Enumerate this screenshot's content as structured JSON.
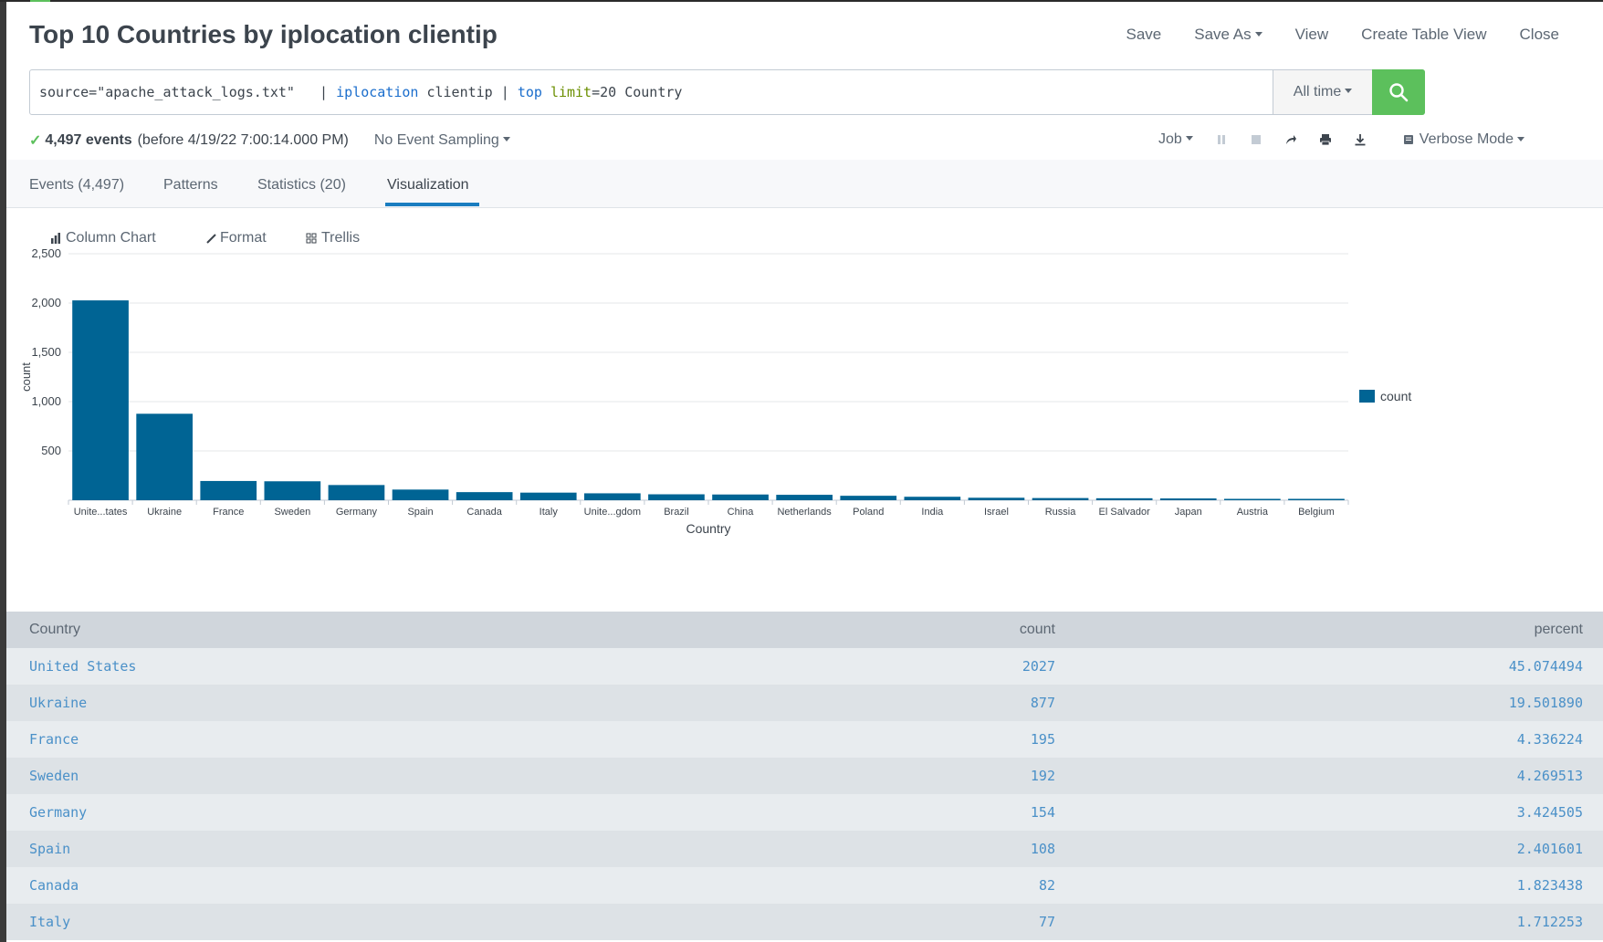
{
  "title": "Top 10 Countries by iplocation clientip",
  "header_actions": [
    "Save",
    "Save As",
    "View",
    "Create Table View",
    "Close"
  ],
  "search": {
    "query_parts": {
      "source": "source=\"apache_attack_logs.txt\"",
      "pipe1": "   | ",
      "cmd1": "iplocation",
      "arg1": " clientip | ",
      "cmd2": "top",
      "sp": " ",
      "opt": "limit",
      "rest": "=20 Country"
    },
    "time_range": "All time"
  },
  "status": {
    "count_text": "4,497 events",
    "detail": "(before 4/19/22 7:00:14.000 PM)",
    "sampling": "No Event Sampling",
    "job_label": "Job",
    "mode": "Verbose Mode"
  },
  "tabs": [
    "Events (4,497)",
    "Patterns",
    "Statistics (20)",
    "Visualization"
  ],
  "viz_toolbar": {
    "chart_type": "Column Chart",
    "format": "Format",
    "trellis": "Trellis"
  },
  "chart_data": {
    "type": "bar",
    "categories": [
      "Unite...tates",
      "Ukraine",
      "France",
      "Sweden",
      "Germany",
      "Spain",
      "Canada",
      "Italy",
      "Unite...gdom",
      "Brazil",
      "China",
      "Netherlands",
      "Poland",
      "India",
      "Israel",
      "Russia",
      "El Salvador",
      "Japan",
      "Austria",
      "Belgium"
    ],
    "series": [
      {
        "name": "count",
        "values": [
          2027,
          877,
          195,
          192,
          154,
          108,
          82,
          77,
          70,
          60,
          58,
          55,
          45,
          35,
          25,
          22,
          20,
          18,
          12,
          10
        ],
        "color": "#006494"
      }
    ],
    "ylim": [
      0,
      2500
    ],
    "yticks": [
      "500",
      "1,000",
      "1,500",
      "2,000",
      "2,500"
    ],
    "ytick_values": [
      500,
      1000,
      1500,
      2000,
      2500
    ],
    "xlabel": "Country",
    "ylabel": "count",
    "legend_position": "right",
    "grid": true
  },
  "table": {
    "columns": [
      "Country",
      "count",
      "percent"
    ],
    "rows": [
      [
        "United States",
        "2027",
        "45.074494"
      ],
      [
        "Ukraine",
        "877",
        "19.501890"
      ],
      [
        "France",
        "195",
        "4.336224"
      ],
      [
        "Sweden",
        "192",
        "4.269513"
      ],
      [
        "Germany",
        "154",
        "3.424505"
      ],
      [
        "Spain",
        "108",
        "2.401601"
      ],
      [
        "Canada",
        "82",
        "1.823438"
      ],
      [
        "Italy",
        "77",
        "1.712253"
      ]
    ]
  },
  "colors": {
    "accent_green": "#5cc05c",
    "bar": "#006494",
    "tab_underline": "#1a7dc0",
    "link": "#4a90c8"
  }
}
